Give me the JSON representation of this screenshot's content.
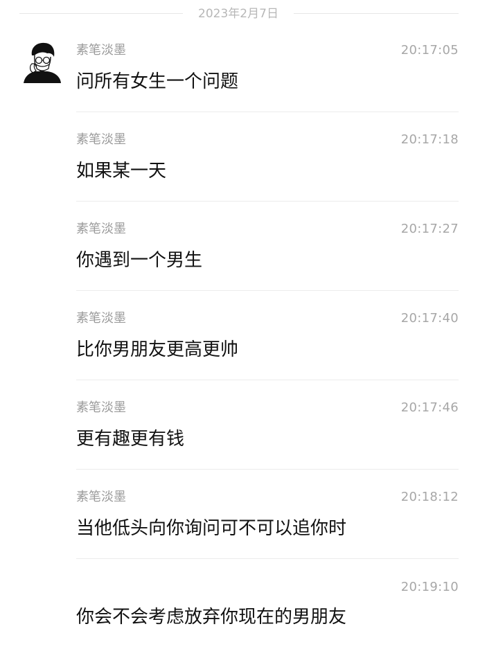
{
  "date_separator": "2023年2月7日",
  "messages": [
    {
      "sender": "素笔淡墨",
      "time": "20:17:05",
      "text": "问所有女生一个问题"
    },
    {
      "sender": "素笔淡墨",
      "time": "20:17:18",
      "text": "如果某一天"
    },
    {
      "sender": "素笔淡墨",
      "time": "20:17:27",
      "text": "你遇到一个男生"
    },
    {
      "sender": "素笔淡墨",
      "time": "20:17:40",
      "text": "比你男朋友更高更帅"
    },
    {
      "sender": "素笔淡墨",
      "time": "20:17:46",
      "text": "更有趣更有钱"
    },
    {
      "sender": "素笔淡墨",
      "time": "20:18:12",
      "text": "当他低头向你询问可不可以追你时"
    },
    {
      "sender": "",
      "time": "20:19:10",
      "text": "你会不会考虑放弃你现在的男朋友"
    }
  ]
}
